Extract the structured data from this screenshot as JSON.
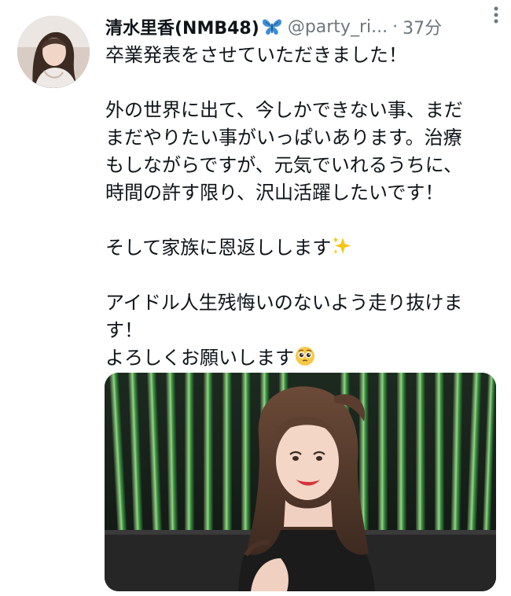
{
  "tweet": {
    "display_name": "清水里香(NMB48)",
    "name_badge_icon": "butterfly-icon",
    "handle": "@party_ri...",
    "separator": "·",
    "timestamp": "37分",
    "menu_icon": "more-vertical-icon",
    "avatar_icon": "profile-photo",
    "lines": [
      "卒業発表をさせていただきました！",
      "",
      "外の世界に出て、今しかできない事、まだ",
      "まだやりたい事がいっぱいあります。治療",
      "もしながらですが、元気でいれるうちに、",
      "時間の許す限り、沢山活躍したいです！",
      "",
      "そして家族に恩返しします",
      "",
      "アイドル人生残悔いのないよう走り抜けま",
      "す！",
      "よろしくお願いします"
    ],
    "emojis": {
      "sparkles": "sparkles-emoji",
      "pleading": "pleading-face-emoji"
    },
    "media": {
      "type": "photo",
      "icon": "photo-image"
    }
  }
}
